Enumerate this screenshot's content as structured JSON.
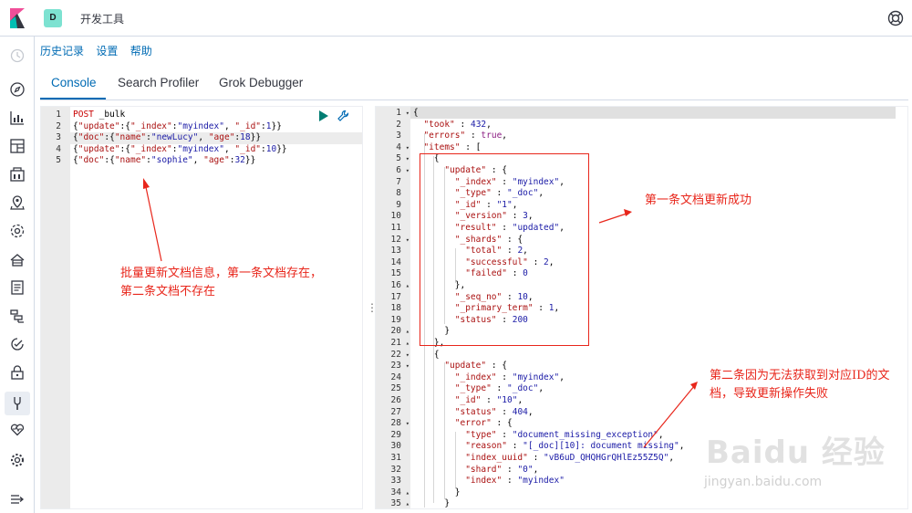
{
  "header": {
    "space_initial": "D",
    "app_title": "开发工具"
  },
  "topmenu": {
    "history": "历史记录",
    "settings": "设置",
    "help": "帮助"
  },
  "tabs": [
    {
      "label": "Console"
    },
    {
      "label": "Search Profiler"
    },
    {
      "label": "Grok Debugger"
    }
  ],
  "nav": {
    "icons": [
      "clock-icon",
      "compass-icon",
      "bar-chart-icon",
      "dashboard-icon",
      "canvas-icon",
      "maps-icon",
      "ml-icon",
      "infrastructure-icon",
      "logs-icon",
      "apm-icon",
      "uptime-icon",
      "security-icon",
      "dev-tools-icon",
      "monitoring-icon",
      "management-icon",
      "collapse-icon"
    ]
  },
  "request": {
    "lines": [
      {
        "n": "1",
        "text": "POST _bulk"
      },
      {
        "n": "2",
        "text": "{\"update\":{\"_index\":\"myindex\", \"_id\":1}}"
      },
      {
        "n": "3",
        "text": "{\"doc\":{\"name\":\"newLucy\", \"age\":18}}"
      },
      {
        "n": "4",
        "text": "{\"update\":{\"_index\":\"myindex\", \"_id\":10}}"
      },
      {
        "n": "5",
        "text": "{\"doc\":{\"name\":\"sophie\", \"age\":32}}"
      }
    ]
  },
  "response": {
    "lines": [
      {
        "n": "1",
        "f": "-",
        "text": "{"
      },
      {
        "n": "2",
        "f": "",
        "text": "  \"took\" : 432,"
      },
      {
        "n": "3",
        "f": "",
        "text": "  \"errors\" : true,"
      },
      {
        "n": "4",
        "f": "-",
        "text": "  \"items\" : ["
      },
      {
        "n": "5",
        "f": "-",
        "text": "    {"
      },
      {
        "n": "6",
        "f": "-",
        "text": "      \"update\" : {"
      },
      {
        "n": "7",
        "f": "",
        "text": "        \"_index\" : \"myindex\","
      },
      {
        "n": "8",
        "f": "",
        "text": "        \"_type\" : \"_doc\","
      },
      {
        "n": "9",
        "f": "",
        "text": "        \"_id\" : \"1\","
      },
      {
        "n": "10",
        "f": "",
        "text": "        \"_version\" : 3,"
      },
      {
        "n": "11",
        "f": "",
        "text": "        \"result\" : \"updated\","
      },
      {
        "n": "12",
        "f": "-",
        "text": "        \"_shards\" : {"
      },
      {
        "n": "13",
        "f": "",
        "text": "          \"total\" : 2,"
      },
      {
        "n": "14",
        "f": "",
        "text": "          \"successful\" : 2,"
      },
      {
        "n": "15",
        "f": "",
        "text": "          \"failed\" : 0"
      },
      {
        "n": "16",
        "f": "^",
        "text": "        },"
      },
      {
        "n": "17",
        "f": "",
        "text": "        \"_seq_no\" : 10,"
      },
      {
        "n": "18",
        "f": "",
        "text": "        \"_primary_term\" : 1,"
      },
      {
        "n": "19",
        "f": "",
        "text": "        \"status\" : 200"
      },
      {
        "n": "20",
        "f": "^",
        "text": "      }"
      },
      {
        "n": "21",
        "f": "^",
        "text": "    },"
      },
      {
        "n": "22",
        "f": "-",
        "text": "    {"
      },
      {
        "n": "23",
        "f": "-",
        "text": "      \"update\" : {"
      },
      {
        "n": "24",
        "f": "",
        "text": "        \"_index\" : \"myindex\","
      },
      {
        "n": "25",
        "f": "",
        "text": "        \"_type\" : \"_doc\","
      },
      {
        "n": "26",
        "f": "",
        "text": "        \"_id\" : \"10\","
      },
      {
        "n": "27",
        "f": "",
        "text": "        \"status\" : 404,"
      },
      {
        "n": "28",
        "f": "-",
        "text": "        \"error\" : {"
      },
      {
        "n": "29",
        "f": "",
        "text": "          \"type\" : \"document_missing_exception\","
      },
      {
        "n": "30",
        "f": "",
        "text": "          \"reason\" : \"[_doc][10]: document missing\","
      },
      {
        "n": "31",
        "f": "",
        "text": "          \"index_uuid\" : \"vB6uD_QHQHGrQHlEz55Z5Q\","
      },
      {
        "n": "32",
        "f": "",
        "text": "          \"shard\" : \"0\","
      },
      {
        "n": "33",
        "f": "",
        "text": "          \"index\" : \"myindex\""
      },
      {
        "n": "34",
        "f": "^",
        "text": "        }"
      },
      {
        "n": "35",
        "f": "^",
        "text": "      }"
      }
    ]
  },
  "annotations": {
    "left_line1": "批量更新文档信息，第一条文档存在，",
    "left_line2": "第二条文档不存在",
    "right_top": "第一条文档更新成功",
    "right_bottom_line1": "第二条因为无法获取到对应ID的文",
    "right_bottom_line2": "档，导致更新操作失败"
  },
  "watermark": {
    "brand": "Baidu 经验",
    "url": "jingyan.baidu.com"
  }
}
